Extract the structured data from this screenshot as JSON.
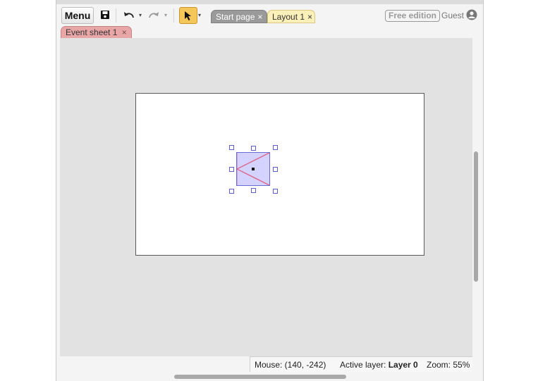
{
  "toolbar": {
    "menu_label": "Menu",
    "save_icon": "save-icon",
    "undo_icon": "undo-icon",
    "redo_icon": "redo-icon",
    "select_tool_icon": "cursor-arrow-icon",
    "dropdown_glyph": "▾"
  },
  "tabs": [
    {
      "label": "Start page",
      "close": "×",
      "active": false
    },
    {
      "label": "Layout 1",
      "close": "×",
      "active": true
    }
  ],
  "event_tab": {
    "label": "Event sheet 1",
    "close": "×"
  },
  "account": {
    "edition_badge": "Free edition",
    "user_label": "Guest",
    "user_icon": "user-circle-icon"
  },
  "status_bar": {
    "mouse_label": "Mouse: (140, -242)",
    "active_layer_label": "Active layer: ",
    "active_layer_value": "Layer 0",
    "zoom_label": "Zoom: 55%"
  },
  "colors": {
    "canvas_bg": "#e2e2e2",
    "sprite_fill": "#d4d3ff",
    "sprite_lines": "#e0507a",
    "select_tool_accent": "#f5c65a",
    "layout_tab_bg": "#fbf0b9",
    "event_tab_bg": "#e8a6a6"
  }
}
